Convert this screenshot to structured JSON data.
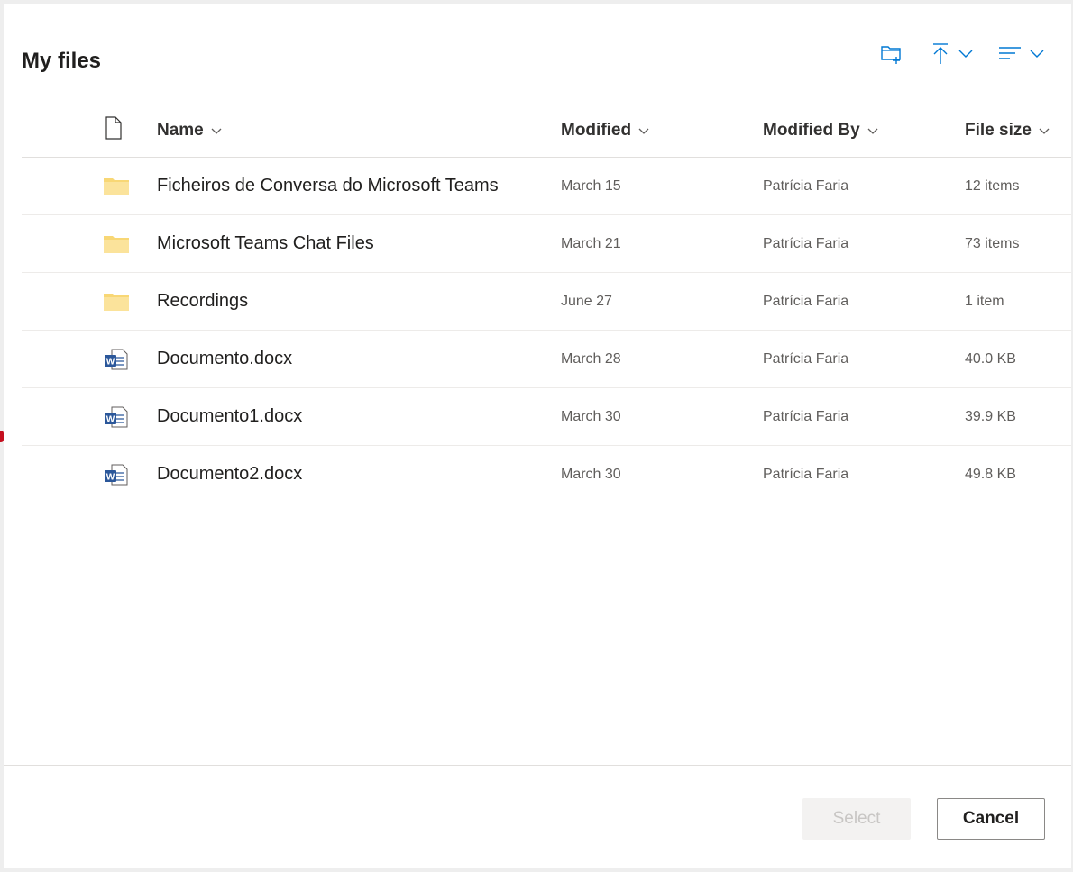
{
  "dialog": {
    "title": "My files"
  },
  "toolbar": {
    "new_folder_icon": "folder-add-icon",
    "upload_icon": "upload-icon",
    "sort_icon": "sort-lines-icon",
    "accent": "#0078d4"
  },
  "columns": {
    "type": "file-icon",
    "name": "Name",
    "modified": "Modified",
    "modified_by": "Modified By",
    "file_size": "File size"
  },
  "rows": [
    {
      "type": "folder",
      "name": "Ficheiros de Conversa do Microsoft Teams",
      "modified": "March 15",
      "modified_by": "Patrícia Faria",
      "size": "12 items"
    },
    {
      "type": "folder",
      "name": "Microsoft Teams Chat Files",
      "modified": "March 21",
      "modified_by": "Patrícia Faria",
      "size": "73 items"
    },
    {
      "type": "folder",
      "name": "Recordings",
      "modified": "June 27",
      "modified_by": "Patrícia Faria",
      "size": "1 item"
    },
    {
      "type": "word",
      "name": "Documento.docx",
      "modified": "March 28",
      "modified_by": "Patrícia Faria",
      "size": "40.0 KB"
    },
    {
      "type": "word",
      "name": "Documento1.docx",
      "modified": "March 30",
      "modified_by": "Patrícia Faria",
      "size": "39.9 KB"
    },
    {
      "type": "word",
      "name": "Documento2.docx",
      "modified": "March 30",
      "modified_by": "Patrícia Faria",
      "size": "49.8 KB"
    }
  ],
  "footer": {
    "select_label": "Select",
    "cancel_label": "Cancel"
  },
  "colors": {
    "folder": "#f8d775",
    "word": "#2b579a",
    "accent": "#0078d4"
  }
}
